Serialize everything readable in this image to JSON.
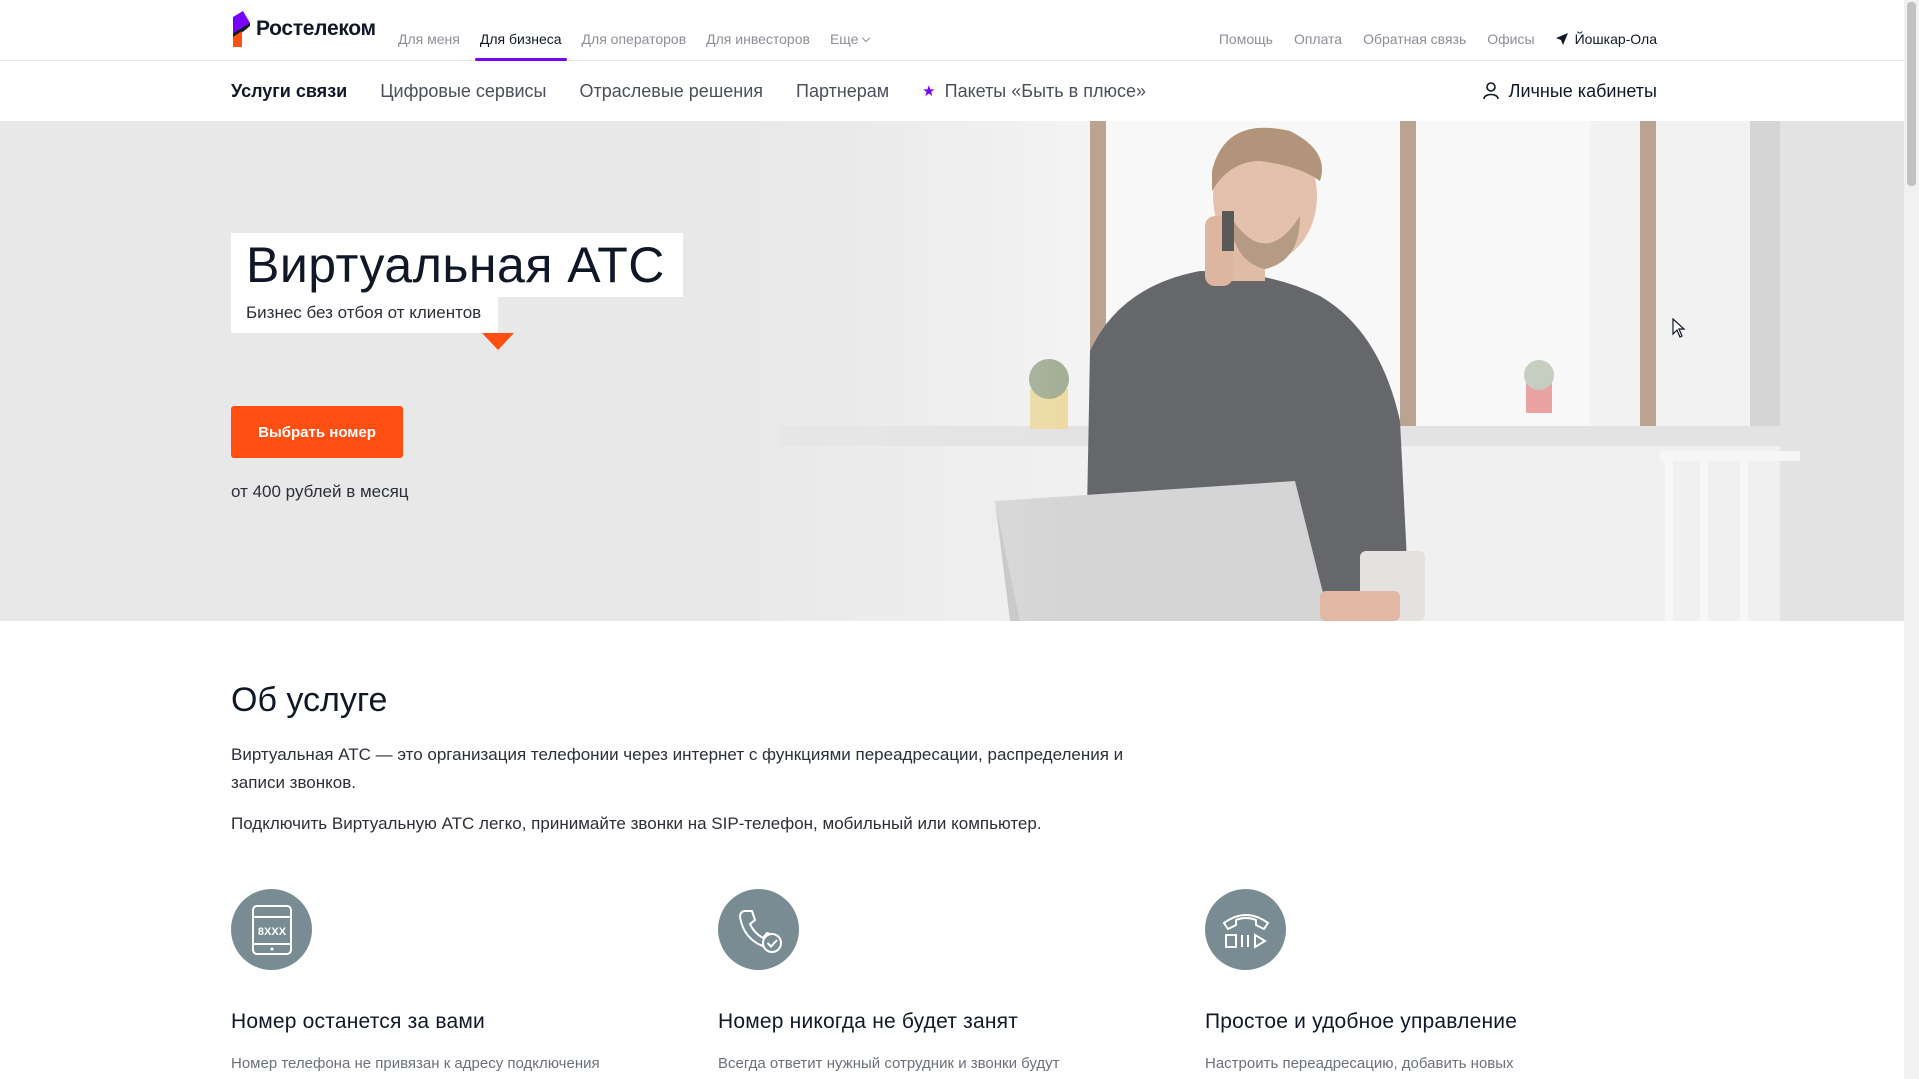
{
  "brand": {
    "name": "Ростелеком",
    "mark_colors": [
      "#7700ff",
      "#ff4f12",
      "#101828"
    ]
  },
  "top_nav": [
    {
      "label": "Для меня",
      "active": false
    },
    {
      "label": "Для бизнеса",
      "active": true
    },
    {
      "label": "Для операторов",
      "active": false
    },
    {
      "label": "Для инвесторов",
      "active": false
    },
    {
      "label": "Еще",
      "active": false
    }
  ],
  "top_links": {
    "help": "Помощь",
    "payment": "Оплата",
    "feedback": "Обратная связь",
    "offices": "Офисы",
    "city": "Йошкар-Ола"
  },
  "sub_nav": {
    "items": [
      {
        "label": "Услуги связи",
        "active": true
      },
      {
        "label": "Цифровые сервисы",
        "active": false
      },
      {
        "label": "Отраслевые решения",
        "active": false
      },
      {
        "label": "Партнерам",
        "active": false
      },
      {
        "label": "Пакеты «Быть в плюсе»",
        "active": false
      }
    ],
    "cabinet": "Личные кабинеты"
  },
  "hero": {
    "title": "Виртуальная АТС",
    "subtitle": "Бизнес без отбоя от клиентов",
    "button": "Выбрать номер",
    "price": "от 400 рублей в месяц",
    "image": "man-talking-on-phone-with-laptop-in-kitchen"
  },
  "about": {
    "title": "Об услуге",
    "paragraph1": "Виртуальная АТС — это организация телефонии через интернет с функциями переадресации, распределения и записи звонков.",
    "paragraph2": "Подключить Виртуальную АТС легко, принимайте звонки на SIP-телефон, мобильный или компьютер.",
    "features": [
      {
        "icon": "phone-number-8xxx-icon",
        "icon_text": "8XXX",
        "title": "Номер останется за вами",
        "text": "Номер телефона не привязан к адресу подключения"
      },
      {
        "icon": "phone-check-icon",
        "title": "Номер никогда не будет занят",
        "text": "Всегда ответит нужный сотрудник и звонки будут"
      },
      {
        "icon": "desk-phone-controls-icon",
        "title": "Простое и удобное управление",
        "text": "Настроить переадресацию, добавить новых"
      }
    ]
  },
  "colors": {
    "accent": "#ff4f12",
    "brand_purple": "#7700ff",
    "icon_circle": "#7a8c93"
  }
}
